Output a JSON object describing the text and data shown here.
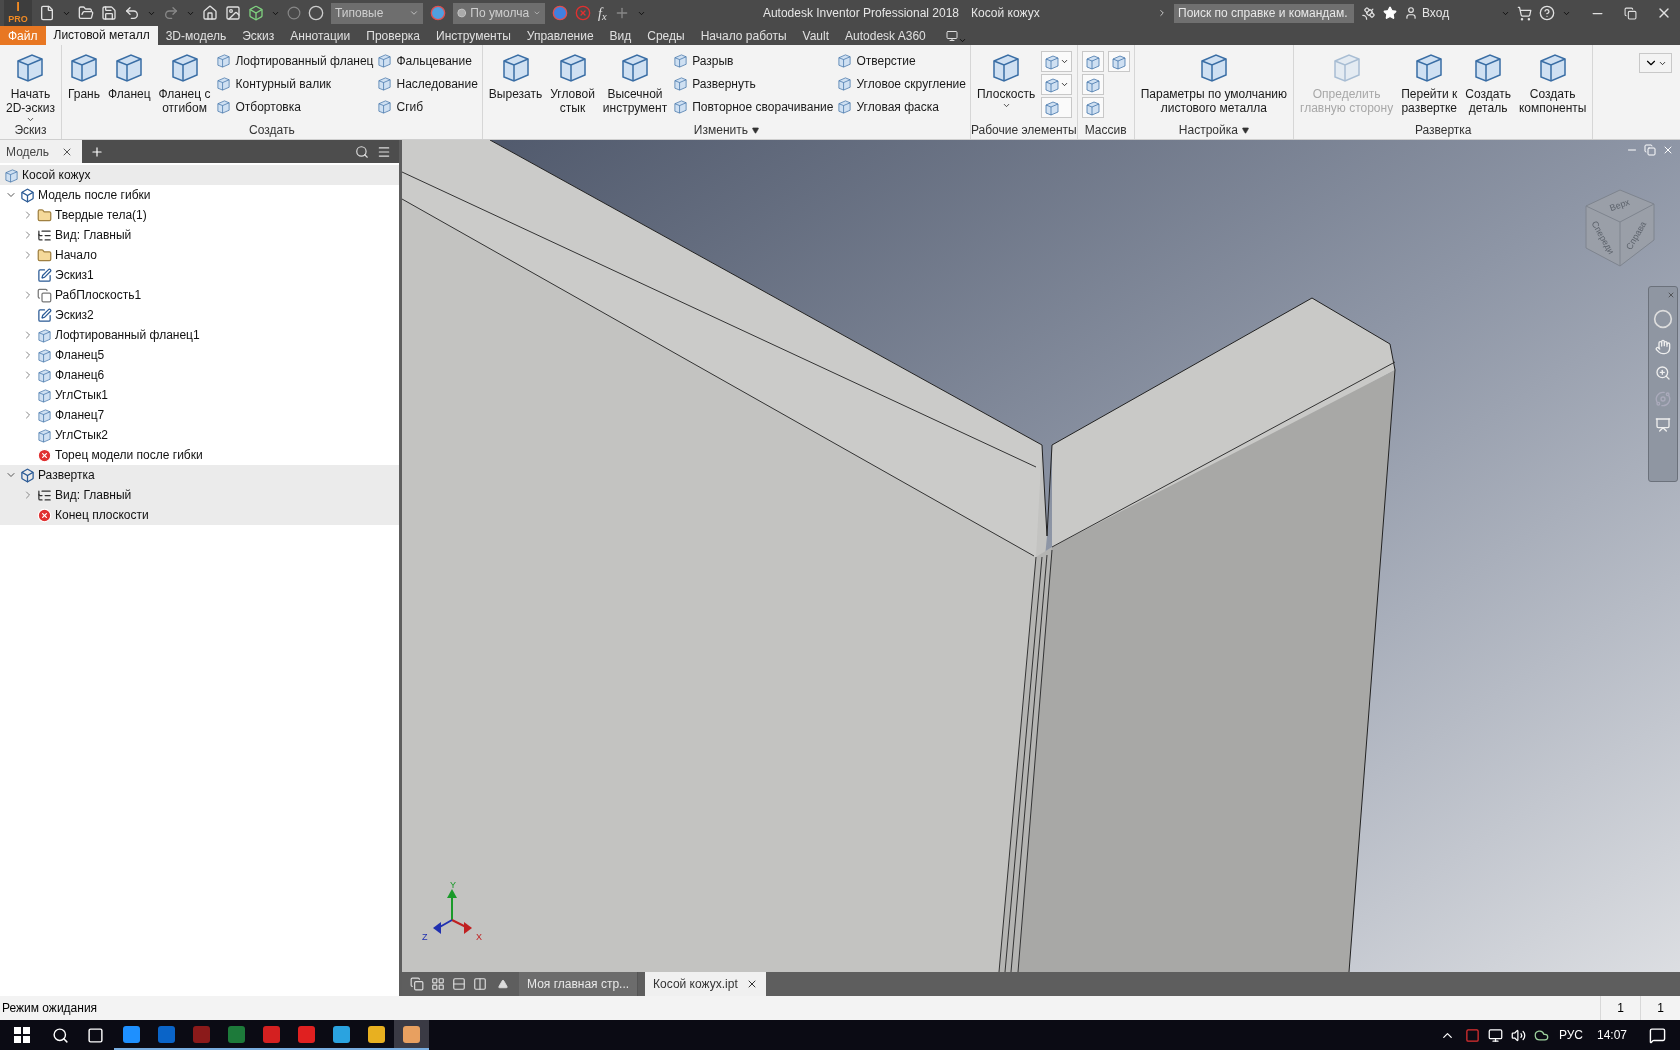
{
  "title_bar": {
    "logo_letter": "I",
    "logo_text": "PRO",
    "style_dropdown": "Типовые",
    "material_dropdown": "По умолча",
    "function_symbol": "f$_{x}$",
    "app_title": "Autodesk Inventor Professional 2018",
    "document_title": "Косой кожух",
    "search": {
      "placeholder": "Поиск по справке и командам."
    },
    "sign_in": "Вход"
  },
  "tabs": [
    {
      "label": "Файл",
      "kind": "file",
      "selected": false
    },
    {
      "label": "Листовой металл",
      "kind": "tab",
      "selected": true
    },
    {
      "label": "3D-модель",
      "kind": "tab",
      "selected": false
    },
    {
      "label": "Эскиз",
      "kind": "tab",
      "selected": false
    },
    {
      "label": "Аннотации",
      "kind": "tab",
      "selected": false
    },
    {
      "label": "Проверка",
      "kind": "tab",
      "selected": false
    },
    {
      "label": "Инструменты",
      "kind": "tab",
      "selected": false
    },
    {
      "label": "Управление",
      "kind": "tab",
      "selected": false
    },
    {
      "label": "Вид",
      "kind": "tab",
      "selected": false
    },
    {
      "label": "Среды",
      "kind": "tab",
      "selected": false
    },
    {
      "label": "Начало работы",
      "kind": "tab",
      "selected": false
    },
    {
      "label": "Vault",
      "kind": "tab",
      "selected": false
    },
    {
      "label": "Autodesk A360",
      "kind": "tab",
      "selected": false
    }
  ],
  "ribbon": [
    {
      "title": "Эскиз",
      "menu": false,
      "items": [
        {
          "kind": "large",
          "label": "Начать\n2D-эскиз",
          "caret": true,
          "disabled": false
        }
      ]
    },
    {
      "title": "Создать",
      "menu": false,
      "items": [
        {
          "kind": "large",
          "label": "Грань",
          "disabled": false
        },
        {
          "kind": "large",
          "label": "Фланец",
          "disabled": false
        },
        {
          "kind": "large",
          "label": "Фланец с\nотгибом",
          "disabled": false
        },
        {
          "kind": "column",
          "items": [
            "Лофтированный фланец",
            "Контурный валик",
            "Отбортовка"
          ]
        },
        {
          "kind": "column",
          "items": [
            "Фальцевание",
            "Наследование",
            "Сгиб"
          ]
        }
      ]
    },
    {
      "title": "Изменить",
      "menu": true,
      "items": [
        {
          "kind": "large",
          "label": "Вырезать",
          "disabled": false
        },
        {
          "kind": "large",
          "label": "Угловой\nстык",
          "disabled": false
        },
        {
          "kind": "large",
          "label": "Высечной\nинструмент",
          "disabled": false
        },
        {
          "kind": "column",
          "items": [
            "Разрыв",
            "Развернуть",
            "Повторное сворачивание"
          ]
        },
        {
          "kind": "column",
          "items": [
            "Отверстие",
            "Угловое скругление",
            "Угловая фаска"
          ]
        }
      ]
    },
    {
      "title": "Рабочие элементы",
      "menu": false,
      "items": [
        {
          "kind": "large",
          "label": "Плоскость",
          "caret": true,
          "disabled": false
        },
        {
          "kind": "icons",
          "items": [
            {
              "caret": true
            },
            {
              "caret": true
            },
            {
              "caret": false
            }
          ]
        }
      ]
    },
    {
      "title": "Массив",
      "menu": false,
      "items": [
        {
          "kind": "icons",
          "items": [
            {
              "caret": false
            },
            {
              "caret": false
            },
            {
              "caret": false
            }
          ]
        },
        {
          "kind": "icons",
          "items": [
            {
              "caret": false
            }
          ]
        }
      ]
    },
    {
      "title": "Настройка",
      "menu": true,
      "items": [
        {
          "kind": "large",
          "label": "Параметры по умолчанию\nлистового металла",
          "disabled": false
        }
      ]
    },
    {
      "title": "Развертка",
      "menu": false,
      "items": [
        {
          "kind": "large",
          "label": "Определить\nглавную сторону",
          "disabled": true
        },
        {
          "kind": "large",
          "label": "Перейти к\nразвертке",
          "disabled": false
        },
        {
          "kind": "large",
          "label": "Создать\nдеталь",
          "disabled": false
        },
        {
          "kind": "large",
          "label": "Создать\nкомпоненты",
          "disabled": false
        }
      ]
    }
  ],
  "browser": {
    "tab": "Модель",
    "tree": [
      {
        "label": "Косой кожух",
        "kind": "part",
        "highlighted": true,
        "children": [
          {
            "label": "Модель после гибки",
            "kind": "group",
            "expanded": true,
            "highlighted": false,
            "children": [
              {
                "label": "Твердые тела(1)",
                "kind": "folder",
                "expanded": false,
                "highlighted": false
              },
              {
                "label": "Вид: Главный",
                "kind": "view",
                "expanded": false,
                "highlighted": false
              },
              {
                "label": "Начало",
                "kind": "folder",
                "expanded": false,
                "highlighted": false
              },
              {
                "label": "Эскиз1",
                "kind": "sketch",
                "highlighted": false
              },
              {
                "label": "РабПлоскость1",
                "kind": "plane",
                "expanded": false,
                "highlighted": false
              },
              {
                "label": "Эскиз2",
                "kind": "sketch",
                "highlighted": false
              },
              {
                "label": "Лофтированный фланец1",
                "kind": "feature",
                "expanded": false,
                "highlighted": false
              },
              {
                "label": "Фланец5",
                "kind": "feature",
                "expanded": false,
                "highlighted": false
              },
              {
                "label": "Фланец6",
                "kind": "feature",
                "expanded": false,
                "highlighted": false
              },
              {
                "label": "УглСтык1",
                "kind": "feature",
                "highlighted": false
              },
              {
                "label": "Фланец7",
                "kind": "feature",
                "expanded": false,
                "highlighted": false
              },
              {
                "label": "УглСтык2",
                "kind": "feature",
                "highlighted": false
              },
              {
                "label": "Торец модели после гибки",
                "kind": "end",
                "highlighted": false
              }
            ]
          },
          {
            "label": "Развертка",
            "kind": "group",
            "expanded": true,
            "highlighted": true,
            "children": [
              {
                "label": "Вид: Главный",
                "kind": "view",
                "expanded": false,
                "highlighted": true
              },
              {
                "label": "Конец плоскости",
                "kind": "end",
                "highlighted": true
              }
            ]
          }
        ]
      }
    ]
  },
  "viewport": {
    "view_cube": [
      "Верх",
      "Спереди",
      "Справа"
    ],
    "axes": [
      "Y",
      "Z",
      "X"
    ]
  },
  "document_tabs": [
    {
      "label": "Моя главная стр...",
      "selected": false
    },
    {
      "label": "Косой кожух.ipt",
      "selected": true
    }
  ],
  "status_bar": {
    "message": "Режим ожидания",
    "fields": [
      "1",
      "1"
    ]
  },
  "taskbar": {
    "apps": [
      {
        "color": "#1e90ff",
        "selected": false
      },
      {
        "color": "#0a64c8",
        "selected": false
      },
      {
        "color": "#8b1a1a",
        "selected": false
      },
      {
        "color": "#1d7a3a",
        "selected": false
      },
      {
        "color": "#d42020",
        "selected": false
      },
      {
        "color": "#e02020",
        "selected": false
      },
      {
        "color": "#2aa3e0",
        "selected": false
      },
      {
        "color": "#e8b020",
        "selected": false
      },
      {
        "color": "#e8a060",
        "selected": true
      }
    ],
    "language": "РУС",
    "time": "14:07"
  }
}
